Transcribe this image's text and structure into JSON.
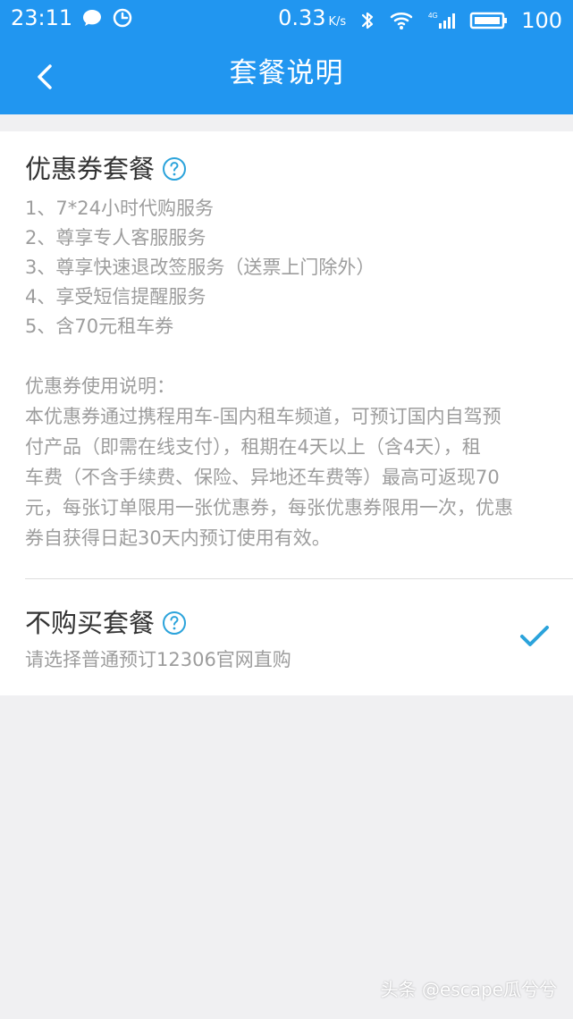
{
  "status_bar": {
    "time": "23:11",
    "network_speed": "0.33",
    "network_speed_unit": "K/s",
    "battery": "100",
    "icons": [
      "message-icon",
      "clock-icon",
      "bluetooth-icon",
      "wifi-icon",
      "signal-icon",
      "battery-icon"
    ],
    "network_type": "4G"
  },
  "header": {
    "title": "套餐说明",
    "back_icon": "back-icon",
    "bg_color": "#2196f0"
  },
  "package1": {
    "title": "优惠券套餐",
    "help_icon": "help-icon",
    "items": [
      "1、7*24小时代购服务",
      "2、尊享专人客服服务",
      "3、尊享快速退改签服务（送票上门除外）",
      "4、享受短信提醒服务",
      "5、含70元租车券"
    ],
    "notes_title": "优惠券使用说明：",
    "notes_lines": [
      "本优惠券通过携程用车-国内租车频道，可预订国内自驾预",
      "付产品（即需在线支付），租期在4天以上（含4天），租",
      "车费（不含手续费、保险、异地还车费等）最高可返现70",
      "元，每张订单限用一张优惠券，每张优惠券限用一次，优惠",
      "券自获得日起30天内预订使用有效。"
    ]
  },
  "package2": {
    "title": "不购买套餐",
    "help_icon": "help-icon",
    "subtitle": "请选择普通预订12306官网直购",
    "selected": true,
    "check_icon": "check-icon",
    "accent_color": "#2ba3db"
  },
  "watermark": {
    "text": "头条 @escape瓜兮兮"
  }
}
